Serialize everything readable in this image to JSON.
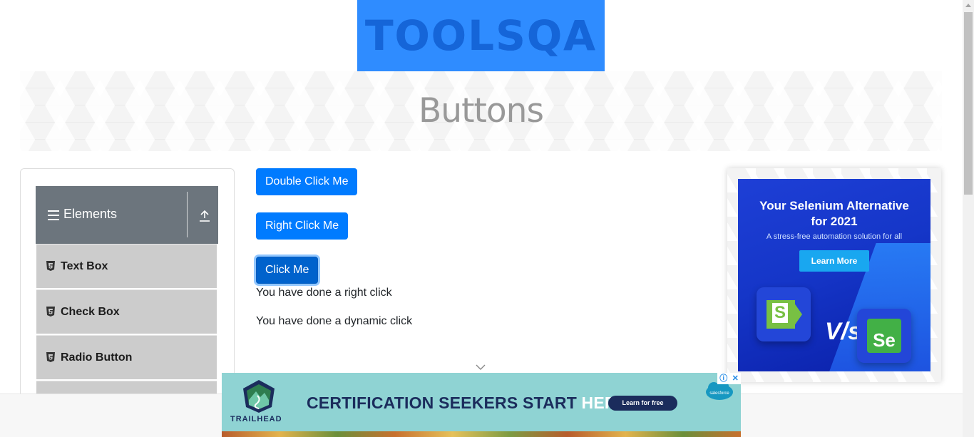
{
  "header": {
    "logo_text": "TOOLSQA"
  },
  "banner": {
    "title": "Buttons"
  },
  "sidebar": {
    "group": {
      "title": "Elements"
    },
    "items": [
      {
        "label": "Text Box"
      },
      {
        "label": "Check Box"
      },
      {
        "label": "Radio Button"
      }
    ]
  },
  "buttons": {
    "double_click": "Double Click Me",
    "right_click": "Right Click Me",
    "click": "Click Me"
  },
  "messages": {
    "right_click": "You have done a right click",
    "dynamic_click": "You have done a dynamic click"
  },
  "side_ad": {
    "title_line1": "Your Selenium Alternative",
    "title_line2": "for 2021",
    "subtitle": "A stress-free automation solution for all",
    "cta": "Learn More",
    "vs": "V/s",
    "k_letter": "S",
    "se_letter": "Se"
  },
  "bottom_ad": {
    "brand": "TRAILHEAD",
    "headline_main": "CERTIFICATION SEEKERS START ",
    "headline_highlight": "HERE.",
    "cta": "Learn for free",
    "sponsor": "salesforce"
  },
  "colors": {
    "primary": "#007bff",
    "sidebar_header": "#6c757d",
    "menu_item": "#cccccc",
    "logo_bg": "#2f8cff"
  }
}
